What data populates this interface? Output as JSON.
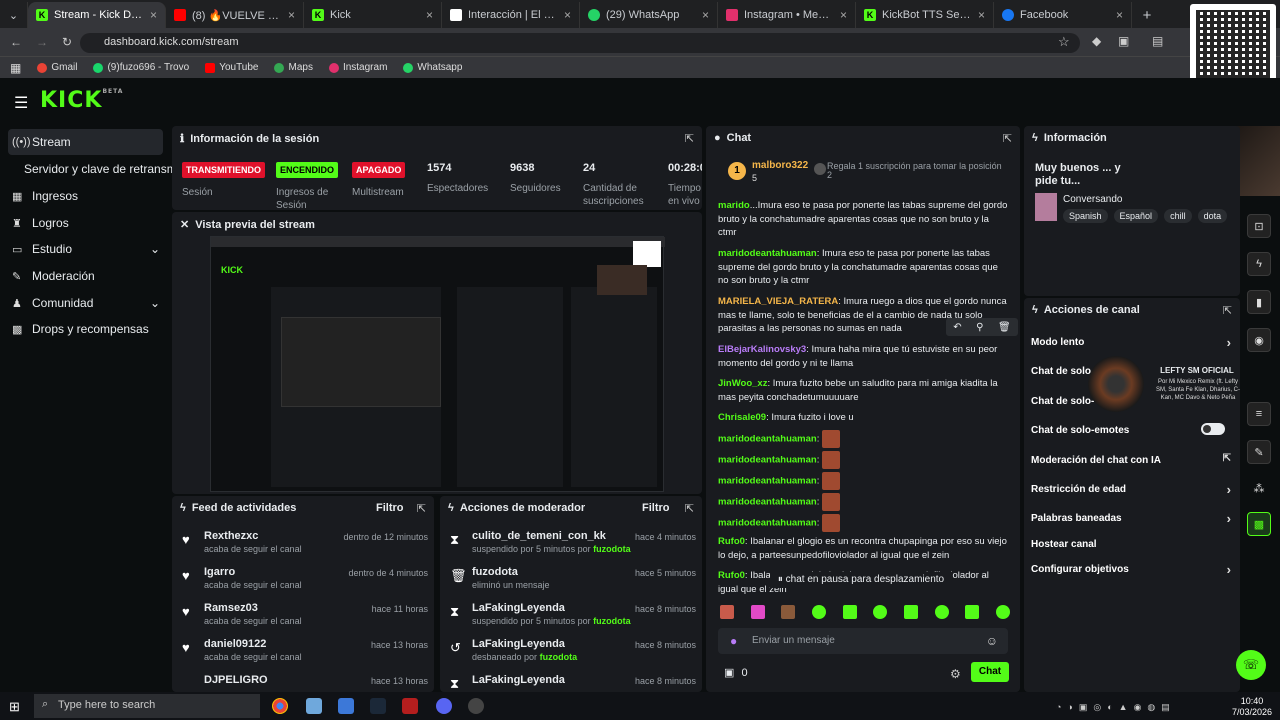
{
  "browser": {
    "tabs": [
      {
        "title": "Stream - Kick Dashboard",
        "active": true,
        "icon": "kick-icon",
        "color": "#53fc18"
      },
      {
        "title": "(8) 🔥VUELVE LA FEKA H",
        "icon": "youtube-icon",
        "color": "#ff0000"
      },
      {
        "title": "Kick",
        "icon": "kick-icon",
        "color": "#53fc18"
      },
      {
        "title": "Interacción | El mejor sof",
        "icon": "interaction-icon",
        "color": "#ffffff"
      },
      {
        "title": "(29) WhatsApp",
        "icon": "whatsapp-icon",
        "color": "#25d366"
      },
      {
        "title": "Instagram • Mensajes",
        "icon": "instagram-icon",
        "color": "#e1306c"
      },
      {
        "title": "KickBot TTS Settings",
        "icon": "kick-icon",
        "color": "#53fc18"
      },
      {
        "title": "Facebook",
        "icon": "facebook-icon",
        "color": "#1877f2"
      }
    ],
    "url": "dashboard.kick.com/stream",
    "bookmarks": [
      {
        "label": "Gmail",
        "color": "#ea4335"
      },
      {
        "label": "(9)fuzo696 - Trovo",
        "color": "#19d66b"
      },
      {
        "label": "YouTube",
        "color": "#ff0000"
      },
      {
        "label": "Maps",
        "color": "#34a853"
      },
      {
        "label": "Instagram",
        "color": "#e1306c"
      },
      {
        "label": "Whatsapp",
        "color": "#25d366"
      }
    ]
  },
  "brand": {
    "logo": "KICK",
    "beta": "BETA",
    "accent": "#53fc18"
  },
  "sidebar": {
    "items": [
      {
        "label": "Stream",
        "icon": "broadcast-icon",
        "active": true
      },
      {
        "label": "Servidor y clave de retransm",
        "icon": "",
        "active": false
      },
      {
        "label": "Ingresos",
        "icon": "money-icon"
      },
      {
        "label": "Logros",
        "icon": "trophy-icon"
      },
      {
        "label": "Estudio",
        "icon": "studio-icon",
        "expand": true
      },
      {
        "label": "Moderación",
        "icon": "wrench-icon"
      },
      {
        "label": "Comunidad",
        "icon": "community-icon",
        "expand": true
      },
      {
        "label": "Drops y recompensas",
        "icon": "gift-icon"
      }
    ]
  },
  "session": {
    "title": "Información de la sesión",
    "badges": [
      {
        "text": "TRANSMITIENDO",
        "label": "Sesión",
        "bg": "#e0112b",
        "fg": "#ffffff"
      },
      {
        "text": "ENCENDIDO",
        "label": "Ingresos de Sesión",
        "bg": "#53fc18",
        "fg": "#000000"
      },
      {
        "text": "APAGADO",
        "label": "Multistream",
        "bg": "#e0112b",
        "fg": "#ffffff"
      }
    ],
    "stats": [
      {
        "value": "1574",
        "label": "Espectadores"
      },
      {
        "value": "9638",
        "label": "Seguidores"
      },
      {
        "value": "24",
        "label": "Cantidad de suscripciones"
      },
      {
        "value": "00:28:0",
        "label": "Tiempo en vivo"
      }
    ]
  },
  "preview": {
    "title": "Vista previa del stream"
  },
  "feed": {
    "title": "Feed de actividades",
    "filter": "Filtro",
    "rows": [
      {
        "name": "Rexthezxc",
        "action": "acaba de seguir el canal",
        "time": "dentro de 12 minutos"
      },
      {
        "name": "Igarro",
        "action": "acaba de seguir el canal",
        "time": "dentro de 4 minutos"
      },
      {
        "name": "Ramsez03",
        "action": "acaba de seguir el canal",
        "time": "hace 11 horas"
      },
      {
        "name": "daniel09122",
        "action": "acaba de seguir el canal",
        "time": "hace 13 horas"
      },
      {
        "name": "DJPELIGRO",
        "action": "",
        "time": "hace 13 horas"
      }
    ]
  },
  "modactions": {
    "title": "Acciones de moderador",
    "filter": "Filtro",
    "rows": [
      {
        "name": "culito_de_temeni_con_kk",
        "action": "suspendido por 5 minutos por",
        "by": "fuzodota",
        "time": "hace 4 minutos",
        "icon": "hourglass-icon"
      },
      {
        "name": "fuzodota",
        "action": "eliminó un mensaje",
        "by": "",
        "time": "hace 5 minutos",
        "icon": "trash-icon"
      },
      {
        "name": "LaFakingLeyenda",
        "action": "suspendido por 5 minutos por",
        "by": "fuzodota",
        "time": "hace 8 minutos",
        "icon": "hourglass-icon"
      },
      {
        "name": "LaFakingLeyenda",
        "action": "desbaneado por",
        "by": "fuzodota",
        "time": "hace 8 minutos",
        "icon": "undo-icon"
      },
      {
        "name": "LaFakingLeyenda",
        "action": "",
        "by": "",
        "time": "hace 8 minutos",
        "icon": "hourglass-icon"
      }
    ]
  },
  "chat": {
    "title": "Chat",
    "pinned_user": "malboro322",
    "pinned_count": "5",
    "gift_text": "Regala 1 suscripción para tomar la posición",
    "gift_pos": "2",
    "messages": [
      {
        "user": "marido",
        "color": "#53fc18",
        "text": "...Imura eso te pasa por ponerte las tabas supreme del gordo bruto y la conchatumadre aparentas cosas que no son bruto y la ctmr"
      },
      {
        "user": "maridodeantahuaman",
        "color": "#53fc18",
        "text": "Imura eso te pasa por ponerte las tabas supreme del gordo bruto y la conchatumadre aparentas cosas que no son bruto y la ctmr"
      },
      {
        "user": "MARIELA_VIEJA_RATERA",
        "color": "#f5b64a",
        "text": "Imura ruego a dios que el gordo nunca mas te llame, solo te beneficias de el a cambio de nada tu solo parasitas a las personas no sumas en nada"
      },
      {
        "user": "ElBejarKalinovsky3",
        "color": "#b87cf7",
        "text": "Imura haha mira que tú estuviste en su peor momento del gordo y ni te llama"
      },
      {
        "user": "JinWoo_xz",
        "color": "#53fc18",
        "text": "Imura fuzito bebe un saludito para mi amiga kiadita la mas peyita conchadetumuuuuare"
      },
      {
        "user": "Chrisale09",
        "color": "#53fc18",
        "text": "Imura fuzito i love u"
      },
      {
        "user": "maridodeantahuaman",
        "color": "#53fc18",
        "text": ""
      },
      {
        "user": "maridodeantahuaman",
        "color": "#53fc18",
        "text": ""
      },
      {
        "user": "maridodeantahuaman",
        "color": "#53fc18",
        "text": ""
      },
      {
        "user": "maridodeantahuaman",
        "color": "#53fc18",
        "text": ""
      },
      {
        "user": "maridodeantahuaman",
        "color": "#53fc18",
        "text": ""
      },
      {
        "user": "Rufo0",
        "color": "#53fc18",
        "text": "Ibalanar el glogio es un recontra chupapinga por eso su viejo lo dejo, a parteesunpedofiloviolador al igual que el zein"
      },
      {
        "user": "Rufo0",
        "color": "#53fc18",
        "text": "Ibala... so su viejo lo dejo, a parteesunpedofiloviolador al igual que el zein"
      }
    ],
    "paused": "chat en pausa para desplazamiento",
    "input_placeholder": "Enviar un mensaje",
    "points": "0",
    "send": "Chat"
  },
  "info": {
    "title": "Información",
    "headline": "Muy buenos ... y pide tu...",
    "category": "Conversando",
    "tags": [
      "Spanish",
      "Español",
      "chill",
      "dota"
    ]
  },
  "channel_actions": {
    "title": "Acciones de canal",
    "items": [
      {
        "label": "Modo lento",
        "type": "chevron"
      },
      {
        "label": "Chat de solo",
        "type": "chevron"
      },
      {
        "label": "Chat de solo-",
        "type": "chevron"
      },
      {
        "label": "Chat de solo-emotes",
        "type": "toggle"
      },
      {
        "label": "Moderación del chat con IA",
        "type": "external"
      },
      {
        "label": "Restricción de edad",
        "type": "chevron"
      },
      {
        "label": "Palabras baneadas",
        "type": "chevron"
      },
      {
        "label": "Hostear canal",
        "type": "none"
      },
      {
        "label": "Configurar objetivos",
        "type": "chevron"
      }
    ]
  },
  "overlay": {
    "title": "LEFTY SM OFICIAL",
    "sub": "Por Mi Mexico Remix (ft. Lefty SM, Santa Fe Klan, Dharius, C-Kan, MC Davo & Neto Peña"
  },
  "taskbar": {
    "search": "Type here to search",
    "time": "10:40",
    "date": "7/03/2026"
  }
}
